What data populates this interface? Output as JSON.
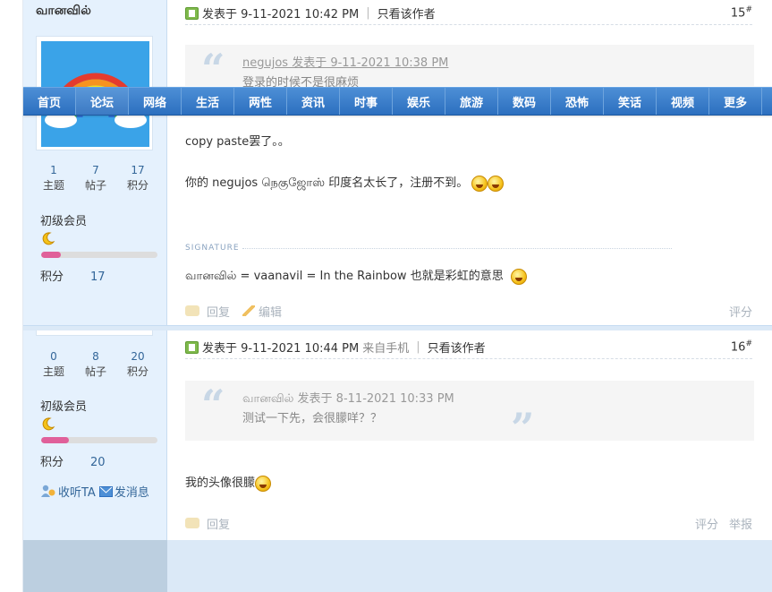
{
  "nav": {
    "items": [
      "首页",
      "论坛",
      "网络",
      "生活",
      "两性",
      "资讯",
      "时事",
      "娱乐",
      "旅游",
      "数码",
      "恐怖",
      "笑话",
      "视频",
      "更多"
    ],
    "active_index": 1
  },
  "post1": {
    "author": {
      "name": "வானவில்",
      "stats": [
        {
          "num": "1",
          "label": "主题"
        },
        {
          "num": "7",
          "label": "帖子"
        },
        {
          "num": "17",
          "label": "积分"
        }
      ],
      "rank": "初级会员",
      "rank_progress": 0.17,
      "score_label": "积分",
      "score": "17"
    },
    "header": {
      "posted": "发表于 9-11-2021 10:42 PM",
      "only_author": "只看该作者",
      "floor": "15",
      "floor_mark": "#"
    },
    "quote": {
      "meta": "negujos 发表于 9-11-2021 10:38 PM",
      "text": "登录的时候不是很麻烦"
    },
    "lines": [
      "copy paste罢了。。",
      "你的 negujos நெகுஜோஸ் 印度名太长了，注册不到。"
    ],
    "signature_label": "SIGNATURE",
    "signature": "வானவில் = vaanavil = In the Rainbow 也就是彩虹的意思",
    "footer": {
      "reply": "回复",
      "edit": "编辑",
      "rate": "评分"
    }
  },
  "post2": {
    "author": {
      "stats": [
        {
          "num": "0",
          "label": "主题"
        },
        {
          "num": "8",
          "label": "帖子"
        },
        {
          "num": "20",
          "label": "积分"
        }
      ],
      "rank": "初级会员",
      "rank_progress": 0.24,
      "score_label": "积分",
      "score": "20",
      "follow": "收听TA",
      "message": "发消息"
    },
    "header": {
      "posted": "发表于 9-11-2021 10:44 PM",
      "mobile": "来自手机",
      "only_author": "只看该作者",
      "floor": "16",
      "floor_mark": "#"
    },
    "quote": {
      "meta": "வானவில் 发表于 8-11-2021 10:33 PM",
      "text": "测试一下先，会很朦咩？？"
    },
    "lines": [
      "我的头像很朦"
    ],
    "footer": {
      "reply": "回复",
      "rate": "评分",
      "report": "举报"
    }
  },
  "colors": {
    "nav_bg": "#2c6fbf",
    "author_bg": "#e5f1fd",
    "link": "#336699",
    "rank_bar": "#e0609a"
  }
}
